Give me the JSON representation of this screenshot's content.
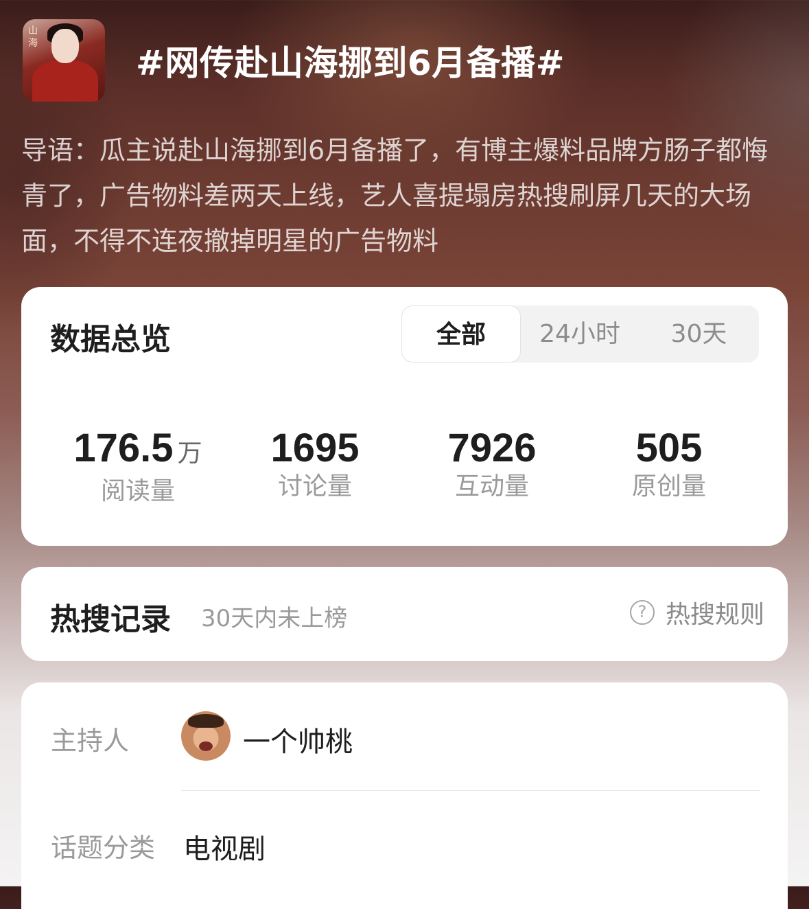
{
  "header": {
    "topic_title": "#网传赴山海挪到6月备播#",
    "intro": "导语：瓜主说赴山海挪到6月备播了，有博主爆料品牌方肠子都悔青了，广告物料差两天上线，艺人喜提塌房热搜刷屏几天的大场面，不得不连夜撤掉明星的广告物料"
  },
  "overview": {
    "heading": "数据总览",
    "tabs": [
      {
        "label": "全部",
        "active": true
      },
      {
        "label": "24小时",
        "active": false
      },
      {
        "label": "30天",
        "active": false
      }
    ],
    "stats": [
      {
        "value": "176.5",
        "unit": "万",
        "label": "阅读量"
      },
      {
        "value": "1695",
        "unit": "",
        "label": "讨论量"
      },
      {
        "value": "7926",
        "unit": "",
        "label": "互动量"
      },
      {
        "value": "505",
        "unit": "",
        "label": "原创量"
      }
    ]
  },
  "hot_search": {
    "heading": "热搜记录",
    "status": "30天内未上榜",
    "rules_icon": "question-circle-icon",
    "rules_label": "热搜规则"
  },
  "info": {
    "host_label": "主持人",
    "host_name": "一个帅桃",
    "category_label": "话题分类",
    "category_value": "电视剧"
  },
  "colors": {
    "header_gradient_top": "#3a1c1a",
    "header_gradient_mid": "#7a4438",
    "card_background": "#ffffff",
    "primary_text": "#1e1e1e",
    "secondary_text": "#9a9a9a"
  }
}
